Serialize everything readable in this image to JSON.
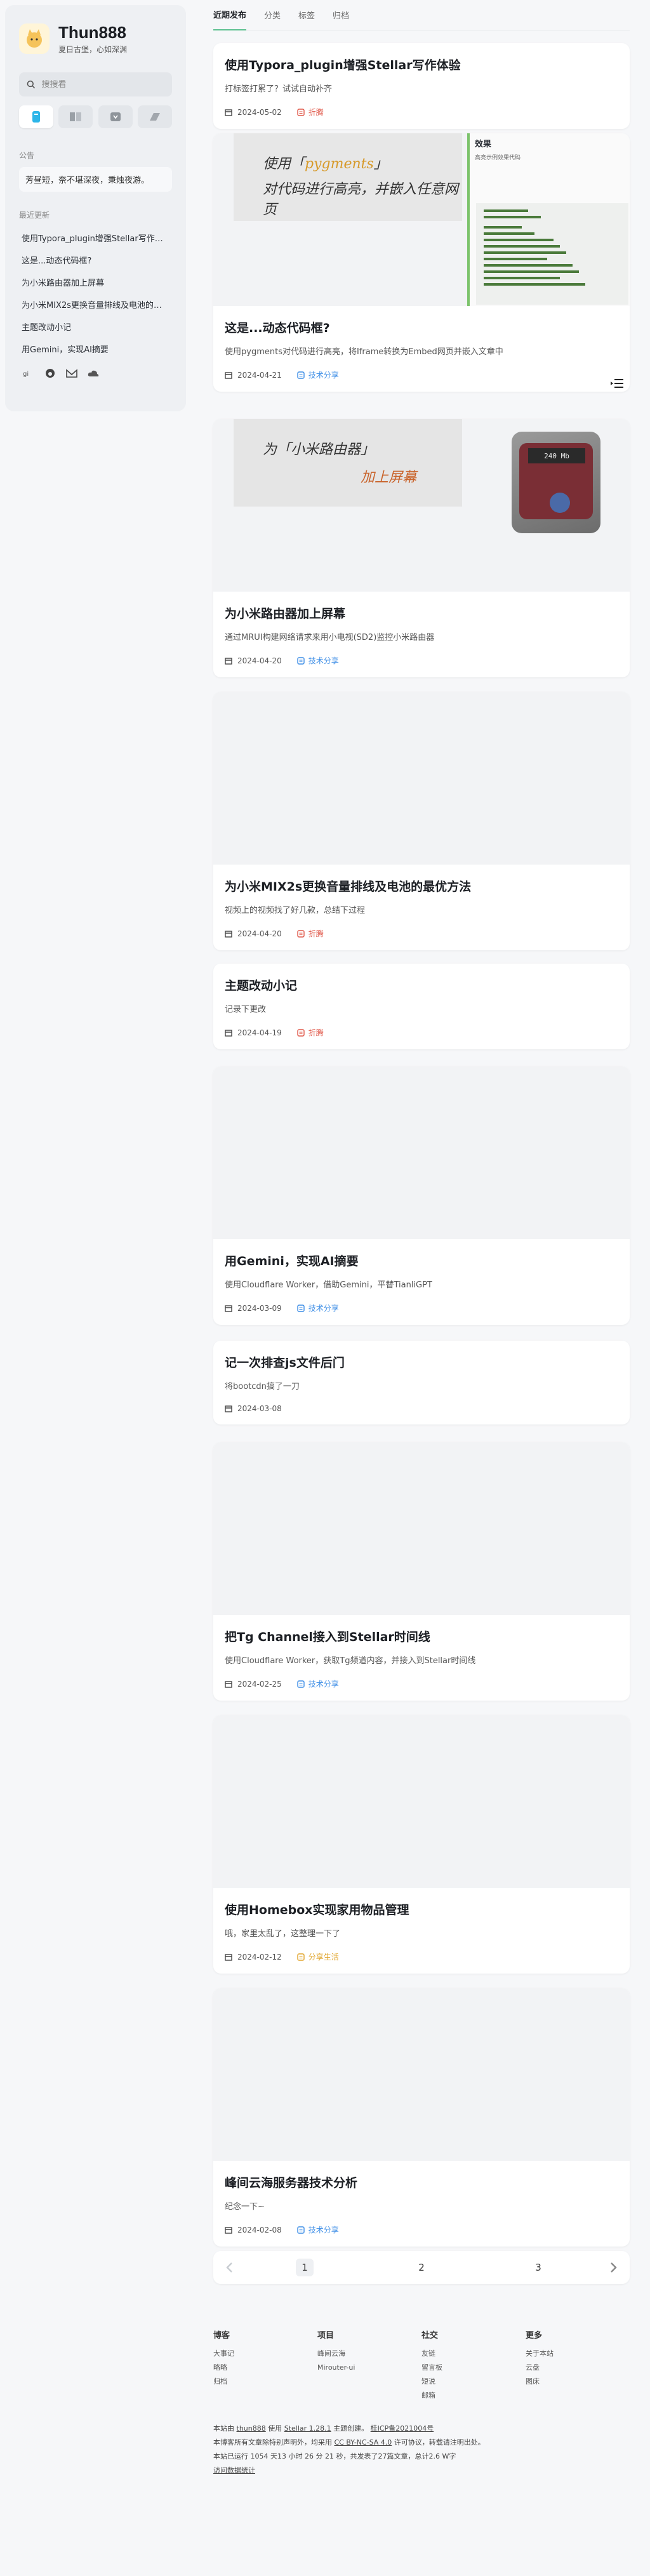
{
  "site": {
    "title": "Thun888",
    "subtitle": "夏日古堡，心如深渊"
  },
  "search": {
    "placeholder": "搜搜看"
  },
  "sidebar": {
    "nav_icons": [
      "home-icon",
      "wiki-icon",
      "bookmark-icon",
      "notes-icon"
    ],
    "notice_title": "公告",
    "notice": "芳昼短，奈不堪深夜，秉烛夜游。",
    "recent_title": "最近更新",
    "recent": [
      "使用Typora_plugin增强Stellar写作体验",
      "这是...动态代码框?",
      "为小米路由器加上屏幕",
      "为小米MIX2s更换音量排线及电池的最优方法",
      "主题改动小记",
      "用Gemini，实现AI摘要"
    ],
    "social": [
      "gitee",
      "github",
      "mail",
      "cloud"
    ]
  },
  "tabs": [
    {
      "label": "近期发布"
    },
    {
      "label": "分类"
    },
    {
      "label": "标签"
    },
    {
      "label": "归档"
    }
  ],
  "posts": [
    {
      "title": "使用Typora_plugin增强Stellar写作体验",
      "excerpt": "打标签打累了？试试自动补齐",
      "date": "2024-05-02",
      "category": "折腾"
    },
    {
      "title": "这是...动态代码框?",
      "excerpt": "使用pygments对代码进行高亮，将Iframe转换为Embed网页并嵌入文章中",
      "date": "2024-04-21",
      "category": "技术分享",
      "cover_text": {
        "line1_prefix": "使用「",
        "line1_em": "pygments",
        "line1_suffix": "」",
        "line2": "对代码进行高亮，并嵌入任意网页",
        "panel_title": "效果",
        "panel_sub": "高亮示例效果代码"
      }
    },
    {
      "title": "为小米路由器加上屏幕",
      "excerpt": "通过MRUI构建网络请求来用小电视(SD2)监控小米路由器",
      "date": "2024-04-20",
      "category": "技术分享",
      "cover_text": {
        "line1": "为「小米路由器」",
        "line2": "加上屏幕",
        "screen": "240 Mb"
      }
    },
    {
      "title": "为小米MIX2s更换音量排线及电池的最优方法",
      "excerpt": "视频上的视频找了好几款，总结下过程",
      "date": "2024-04-20",
      "category": "折腾"
    },
    {
      "title": "主题改动小记",
      "excerpt": "记录下更改",
      "date": "2024-04-19",
      "category": "折腾"
    },
    {
      "title": "用Gemini，实现AI摘要",
      "excerpt": "使用Cloudflare Worker，借助Gemini，平替TianliGPT",
      "date": "2024-03-09",
      "category": "技术分享"
    },
    {
      "title": "记一次排查js文件后门",
      "excerpt": "将bootcdn搞了一刀",
      "date": "2024-03-08",
      "category": ""
    },
    {
      "title": "把Tg Channel接入到Stellar时间线",
      "excerpt": "使用Cloudflare Worker，获取Tg频道内容，并接入到Stellar时间线",
      "date": "2024-02-25",
      "category": "技术分享"
    },
    {
      "title": "使用Homebox实现家用物品管理",
      "excerpt": "哦，家里太乱了，这整理一下了",
      "date": "2024-02-12",
      "category": "分享生活"
    },
    {
      "title": "峰间云海服务器技术分析",
      "excerpt": "纪念一下~",
      "date": "2024-02-08",
      "category": "技术分享"
    }
  ],
  "pagination": {
    "pages": [
      "1",
      "2",
      "3"
    ],
    "current": "1"
  },
  "footer": {
    "columns": [
      {
        "title": "博客",
        "links": [
          "大事记",
          "略略",
          "归档"
        ]
      },
      {
        "title": "项目",
        "links": [
          "峰间云海",
          "Mirouter-ui"
        ]
      },
      {
        "title": "社交",
        "links": [
          "友链",
          "留言板",
          "短说",
          "邮箱"
        ]
      },
      {
        "title": "更多",
        "links": [
          "关于本站",
          "云盘",
          "图床"
        ]
      }
    ],
    "line1_a": "本站由",
    "line1_link1": "thun888",
    "line1_b": "使用",
    "line1_link2": "Stellar 1.28.1",
    "line1_c": "主题创建。",
    "line1_link3": "桂ICP备2021004号",
    "line2_a": "本博客所有文章除特别声明外，均采用",
    "line2_link": "CC BY-NC-SA 4.0",
    "line2_b": "许可协议，转载请注明出处。",
    "line3": "本站已运行 1054 天13 小时 26 分 21 秒，共发表了27篇文章，总计2.6 W字",
    "line4_link": "访问数据统计"
  },
  "colors": {
    "accent": "#5cc08f",
    "cat_tech": "#3c8de6",
    "cat_fiddle": "#e0584a",
    "cat_life": "#e0a42a"
  }
}
